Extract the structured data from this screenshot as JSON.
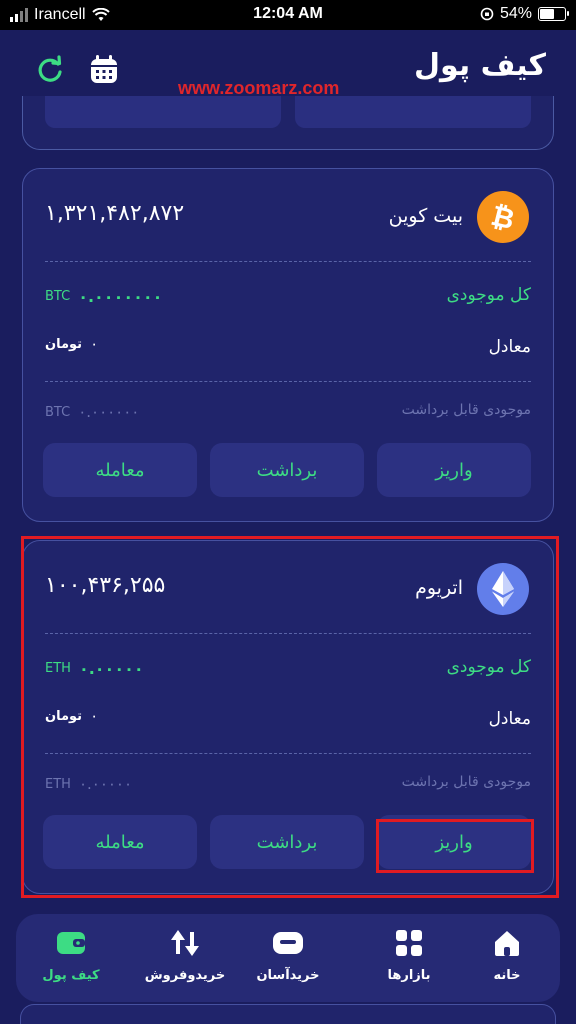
{
  "status_bar": {
    "carrier": "Irancell",
    "time": "12:04 AM",
    "battery": "54%",
    "battery_level": 0.54
  },
  "header": {
    "title": "کیف پول",
    "watermark": "www.zoomarz.com",
    "refresh_icon": "refresh-icon",
    "calendar_icon": "calendar-icon"
  },
  "wallets": [
    {
      "name": "بیت کوین",
      "icon": "bitcoin-icon",
      "price": "۱,۳۲۱,۴۸۲,۸۷۲",
      "total_label": "کل موجودی",
      "total_value": "۰.۰۰۰۰۰۰۰",
      "unit": "BTC",
      "equiv_label": "معادل",
      "equiv_value": "۰",
      "equiv_unit": "تومان",
      "withdrawable_label": "موجودی قابل برداشت",
      "withdrawable_value": "۰.۰۰۰۰۰۰",
      "buttons": {
        "deposit": "واریز",
        "withdraw": "برداشت",
        "trade": "معامله"
      }
    },
    {
      "name": "اتریوم",
      "icon": "ethereum-icon",
      "price": "۱۰۰,۴۳۶,۲۵۵",
      "total_label": "کل موجودی",
      "total_value": "۰.۰۰۰۰۰",
      "unit": "ETH",
      "equiv_label": "معادل",
      "equiv_value": "۰",
      "equiv_unit": "تومان",
      "withdrawable_label": "موجودی قابل برداشت",
      "withdrawable_value": "۰.۰۰۰۰۰",
      "buttons": {
        "deposit": "واریز",
        "withdraw": "برداشت",
        "trade": "معامله"
      }
    }
  ],
  "bottom_nav": {
    "items": [
      {
        "label": "خانه",
        "icon": "home-icon"
      },
      {
        "label": "بازارها",
        "icon": "grid-icon"
      },
      {
        "label": "خریدآسان",
        "icon": "card-icon"
      },
      {
        "label": "خریدوفروش",
        "icon": "buy-sell-icon"
      },
      {
        "label": "کیف پول",
        "icon": "wallet-icon",
        "active": true
      }
    ]
  },
  "colors": {
    "background": "#1a1d5e",
    "card": "#20246b",
    "accent_green": "#3ddc84",
    "highlight_red": "#e11b22",
    "bitcoin": "#f7931a",
    "ethereum": "#627eea"
  }
}
